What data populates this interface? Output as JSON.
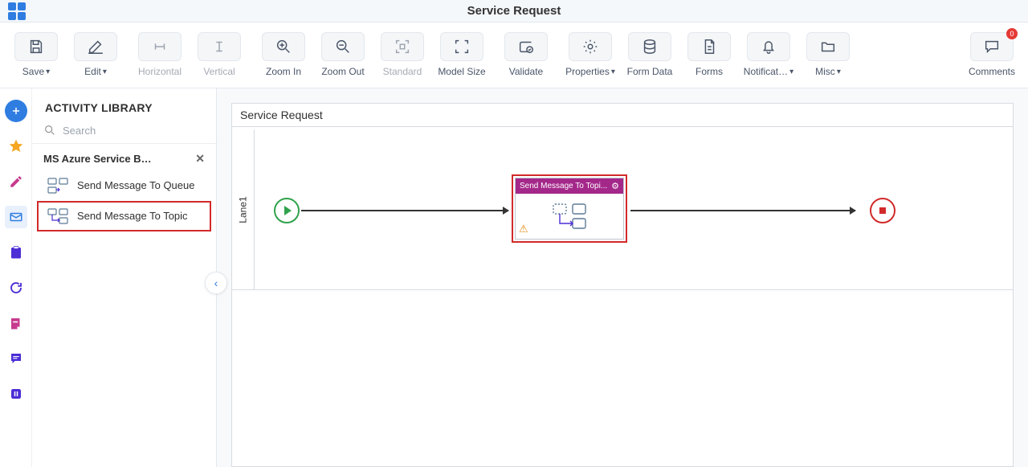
{
  "header": {
    "title": "Service Request"
  },
  "toolbar": {
    "save": "Save",
    "edit": "Edit",
    "horizontal": "Horizontal",
    "vertical": "Vertical",
    "zoom_in": "Zoom In",
    "zoom_out": "Zoom Out",
    "standard": "Standard",
    "model_size": "Model Size",
    "validate": "Validate",
    "properties": "Properties",
    "form_data": "Form Data",
    "forms": "Forms",
    "notifications": "Notificat…",
    "misc": "Misc",
    "comments": "Comments",
    "comment_count": "0"
  },
  "sidebar": {
    "title": "ACTIVITY LIBRARY",
    "search_placeholder": "Search",
    "group_label": "MS Azure Service B…",
    "items": [
      {
        "label": "Send Message To Queue"
      },
      {
        "label": "Send Message To Topic"
      }
    ]
  },
  "canvas": {
    "process_title": "Service Request",
    "lane_label": "Lane1",
    "task_label": "Send Message To Topi..."
  }
}
